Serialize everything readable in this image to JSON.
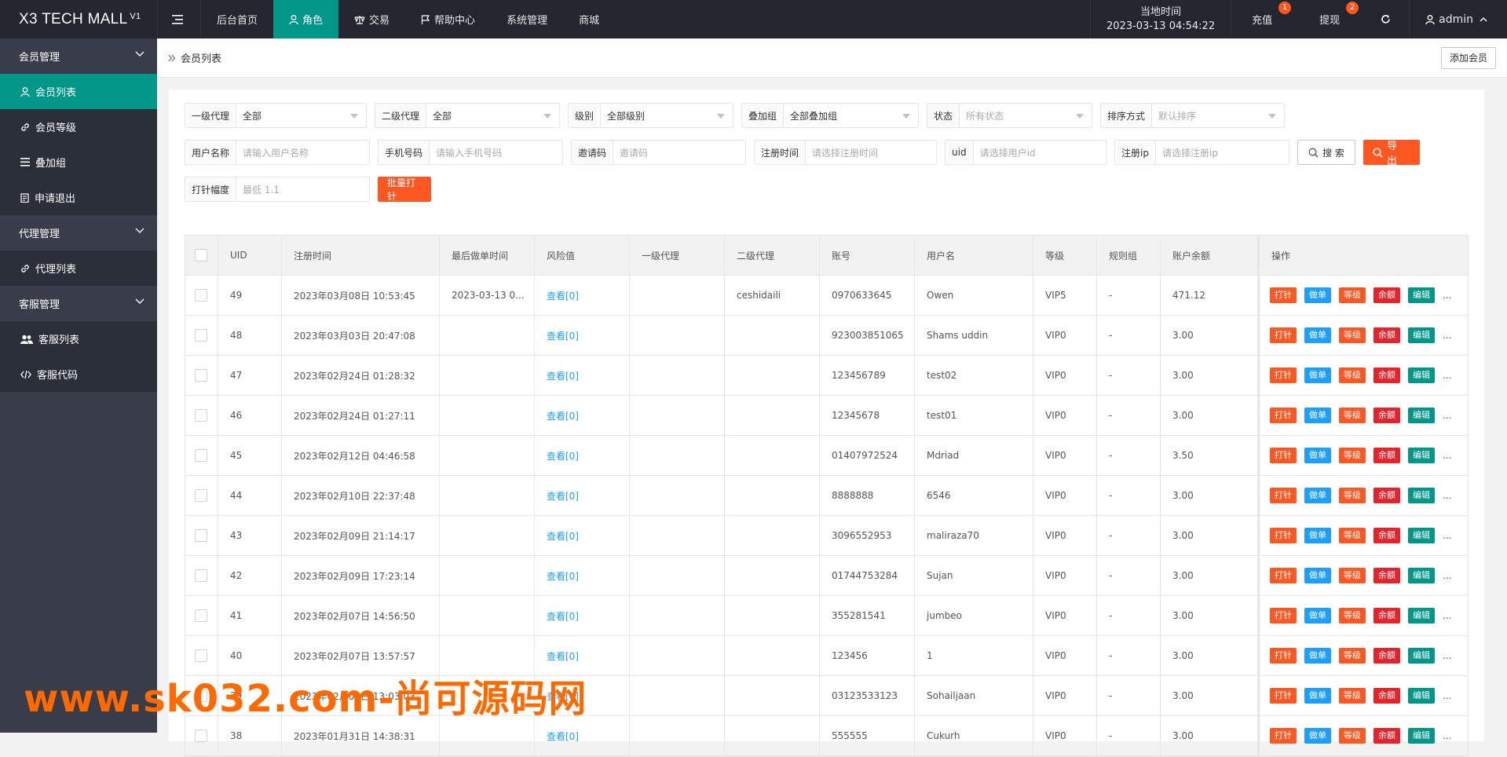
{
  "app": {
    "title": "X3 TECH MALL",
    "version": "V1"
  },
  "topnav": [
    {
      "label": "后台首页",
      "icon": ""
    },
    {
      "label": "角色",
      "icon": "user-icon",
      "active": true
    },
    {
      "label": "交易",
      "icon": "scale-icon"
    },
    {
      "label": "帮助中心",
      "icon": "flag-icon"
    },
    {
      "label": "系统管理",
      "icon": ""
    },
    {
      "label": "商城",
      "icon": ""
    }
  ],
  "clock": {
    "label": "当地时间",
    "value": "2023-03-13 04:54:22"
  },
  "topright": {
    "recharge": "充值",
    "recharge_badge": "1",
    "withdraw": "提现",
    "withdraw_badge": "2",
    "user": "admin"
  },
  "sidebar": {
    "groups": [
      {
        "label": "会员管理",
        "items": [
          "会员列表",
          "会员等级",
          "叠加组",
          "申请退出"
        ]
      },
      {
        "label": "代理管理",
        "items": [
          "代理列表"
        ]
      },
      {
        "label": "客服管理",
        "items": [
          "客服列表",
          "客服代码"
        ]
      }
    ]
  },
  "breadcrumb": "会员列表",
  "add_button": "添加会员",
  "filters": {
    "agent1": {
      "label": "一级代理",
      "value": "全部"
    },
    "agent2": {
      "label": "二级代理",
      "value": "全部"
    },
    "level": {
      "label": "级别",
      "value": "全部级别"
    },
    "group": {
      "label": "叠加组",
      "value": "全部叠加组"
    },
    "status": {
      "label": "状态",
      "placeholder": "所有状态"
    },
    "sort": {
      "label": "排序方式",
      "placeholder": "默认排序"
    },
    "username": {
      "label": "用户名称",
      "placeholder": "请输入用户名称"
    },
    "phone": {
      "label": "手机号码",
      "placeholder": "请输入手机号码"
    },
    "invite": {
      "label": "邀请码",
      "placeholder": "邀请码"
    },
    "regtime": {
      "label": "注册时间",
      "placeholder": "请选择注册时间"
    },
    "uid": {
      "label": "uid",
      "placeholder": "请选择用户id"
    },
    "regip": {
      "label": "注册ip",
      "placeholder": "请选择注册ip"
    },
    "search_btn": "搜 索",
    "export_btn": "导 出",
    "punch": {
      "label": "打针幅度",
      "placeholder": "最低 1.1"
    },
    "batch_btn": "批量打针"
  },
  "table": {
    "headers": [
      "UID",
      "注册时间",
      "最后做单时间",
      "风险值",
      "一级代理",
      "二级代理",
      "账号",
      "用户名",
      "等级",
      "规则组",
      "账户余额",
      "操作"
    ],
    "ops": [
      "打针",
      "做单",
      "等级",
      "余额",
      "编辑",
      "..."
    ],
    "rows": [
      [
        "49",
        "2023年03月08日 10:53:45",
        "2023-03-13 0...",
        "查看[0]",
        "",
        "ceshidaili",
        "0970633645",
        "Owen",
        "VIP5",
        "-",
        "471.12"
      ],
      [
        "48",
        "2023年03月03日 20:47:08",
        "",
        "查看[0]",
        "",
        "",
        "923003851065",
        "Shams uddin",
        "VIP0",
        "-",
        "3.00"
      ],
      [
        "47",
        "2023年02月24日 01:28:32",
        "",
        "查看[0]",
        "",
        "",
        "123456789",
        "test02",
        "VIP0",
        "-",
        "3.00"
      ],
      [
        "46",
        "2023年02月24日 01:27:11",
        "",
        "查看[0]",
        "",
        "",
        "12345678",
        "test01",
        "VIP0",
        "-",
        "3.00"
      ],
      [
        "45",
        "2023年02月12日 04:46:58",
        "",
        "查看[0]",
        "",
        "",
        "01407972524",
        "Mdriad",
        "VIP0",
        "-",
        "3.50"
      ],
      [
        "44",
        "2023年02月10日 22:37:48",
        "",
        "查看[0]",
        "",
        "",
        "8888888",
        "6546",
        "VIP0",
        "-",
        "3.00"
      ],
      [
        "43",
        "2023年02月09日 21:14:17",
        "",
        "查看[0]",
        "",
        "",
        "3096552953",
        "maliraza70",
        "VIP0",
        "-",
        "3.00"
      ],
      [
        "42",
        "2023年02月09日 17:23:14",
        "",
        "查看[0]",
        "",
        "",
        "01744753284",
        "Sujan",
        "VIP0",
        "-",
        "3.00"
      ],
      [
        "41",
        "2023年02月07日 14:56:50",
        "",
        "查看[0]",
        "",
        "",
        "355281541",
        "jumbeo",
        "VIP0",
        "-",
        "3.00"
      ],
      [
        "40",
        "2023年02月07日 13:57:57",
        "",
        "查看[0]",
        "",
        "",
        "123456",
        "1",
        "VIP0",
        "-",
        "3.00"
      ],
      [
        "39",
        "2023年02月05日 13:03:03",
        "",
        "查看[0]",
        "",
        "",
        "03123533123",
        "Sohailjaan",
        "VIP0",
        "-",
        "3.00"
      ],
      [
        "38",
        "2023年01月31日 14:38:31",
        "",
        "查看[0]",
        "",
        "",
        "555555",
        "Cukurh",
        "VIP0",
        "-",
        "3.00"
      ]
    ]
  },
  "watermark": "www.sk032.com-尚可源码网"
}
